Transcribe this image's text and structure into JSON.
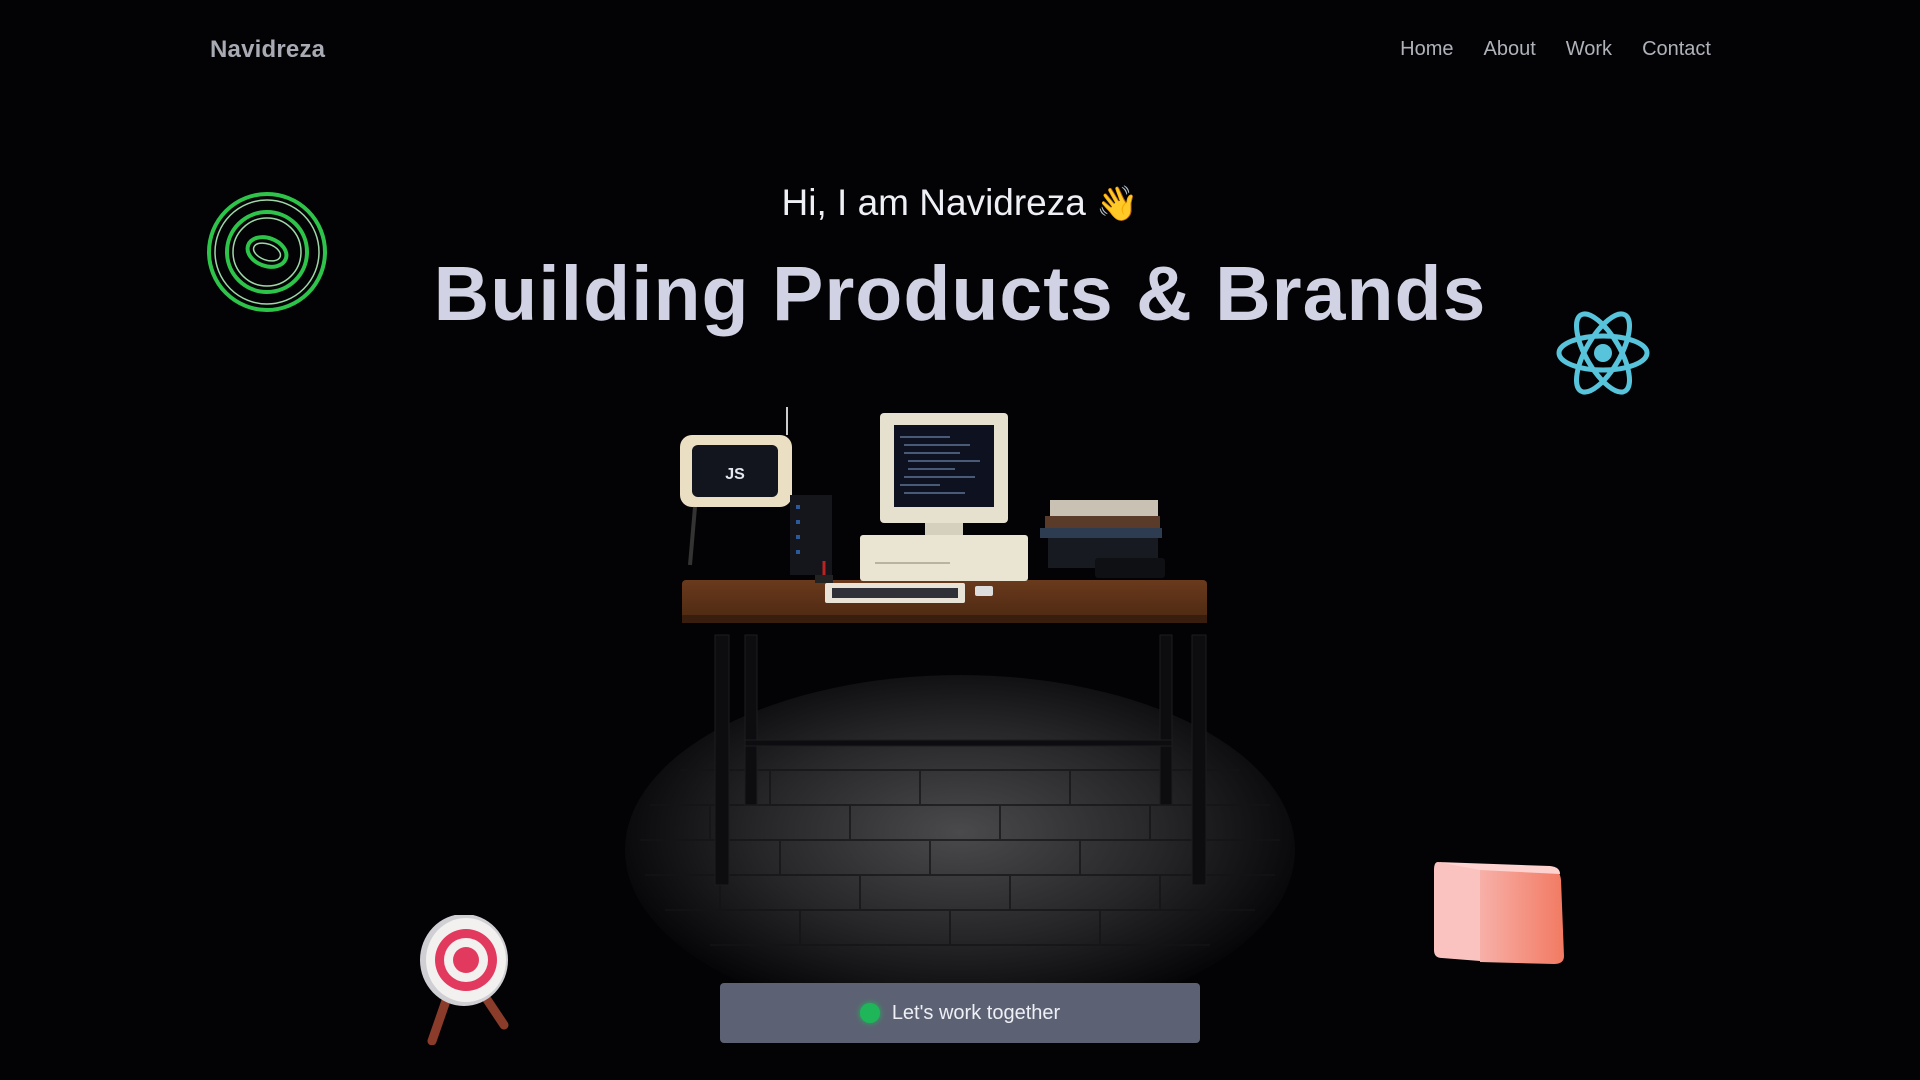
{
  "header": {
    "brand": "Navidreza",
    "nav": [
      "Home",
      "About",
      "Work",
      "Contact"
    ]
  },
  "hero": {
    "greeting": "Hi, I am Navidreza",
    "wave_emoji": "👋",
    "headline": "Building Products & Brands"
  },
  "cta": {
    "label": "Let's work together",
    "status_color": "#1fb65a"
  },
  "decorations": {
    "top_left": "concentric-rings-icon",
    "top_right": "react-logo-icon",
    "bottom_left": "target-icon",
    "bottom_right": "cube-icon"
  },
  "scene": {
    "tv_screen_text": "JS"
  },
  "colors": {
    "background": "#030305",
    "headline": "#d1d3e4",
    "cta_background": "#5c6273",
    "ring_green": "#2ec44a",
    "react_cyan": "#58c4dc",
    "target_red": "#e23a5e",
    "cube_pink": "#f48a78"
  }
}
